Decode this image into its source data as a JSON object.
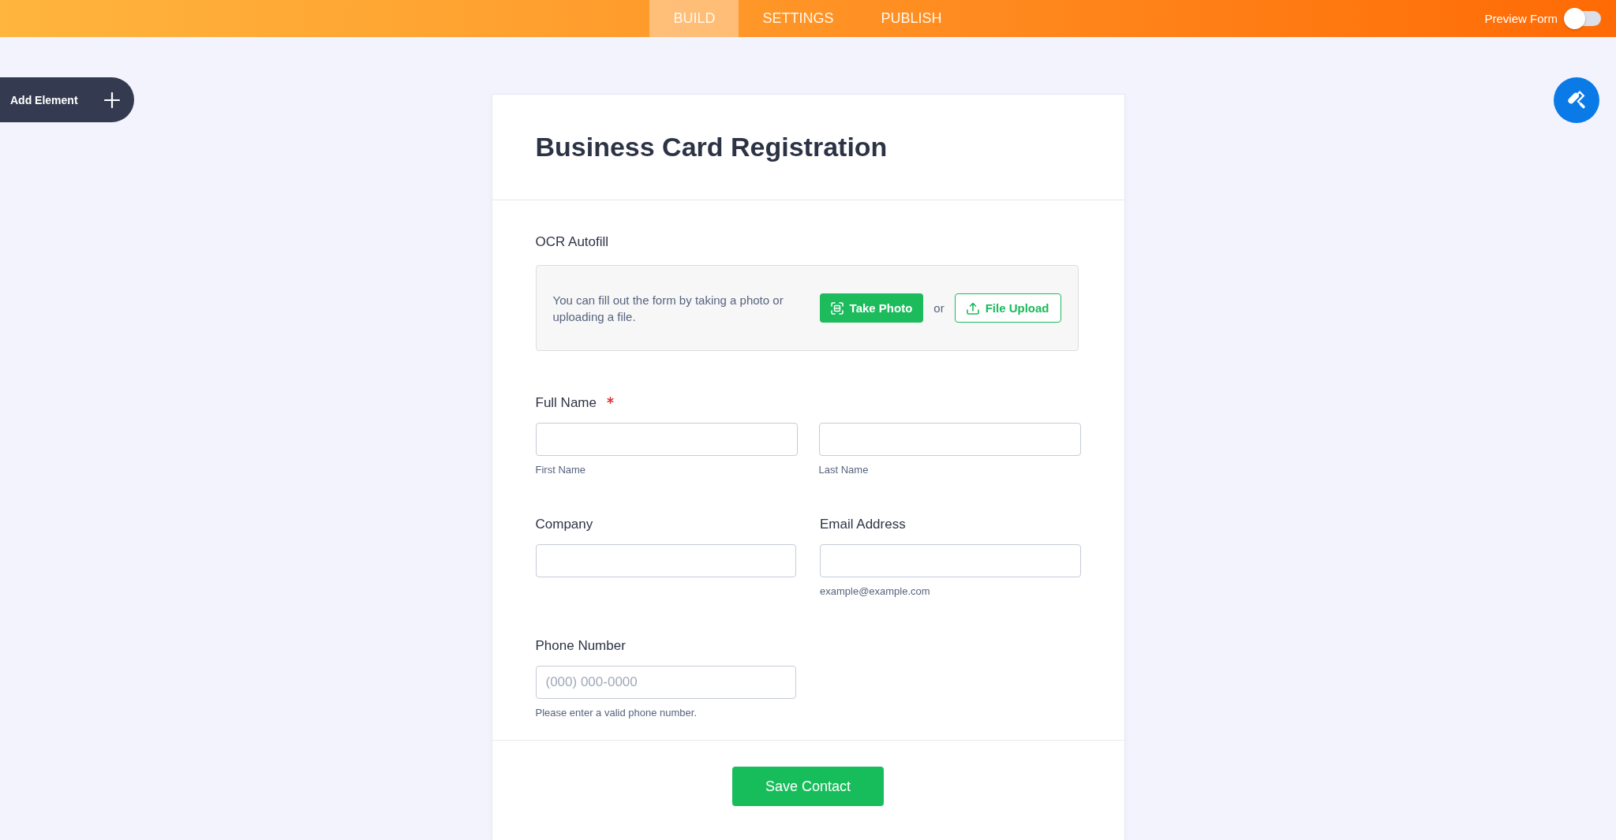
{
  "top_bar": {
    "tabs": [
      {
        "label": "BUILD",
        "selected": true
      },
      {
        "label": "SETTINGS",
        "selected": false
      },
      {
        "label": "PUBLISH",
        "selected": false
      }
    ],
    "preview_toggle": {
      "label": "Preview Form",
      "on": false
    }
  },
  "add_element": {
    "label": "Add Element"
  },
  "form": {
    "title": "Business Card Registration",
    "ocr": {
      "label": "OCR Autofill",
      "description": "You can fill out the form by taking a photo or uploading a file.",
      "buttons": [
        {
          "kind": "photo",
          "label": "Take Photo"
        },
        {
          "kind": "upload",
          "label": "File Upload"
        }
      ],
      "separator": "or"
    },
    "fields": [
      {
        "kind": "pair",
        "label": "Full Name",
        "required": true,
        "sublabels": [
          "First Name",
          "Last Name"
        ]
      },
      {
        "kind": "single",
        "label": "Company",
        "required": false
      },
      {
        "kind": "single",
        "label": "Email Address",
        "required": false,
        "sublabel": "example@example.com"
      },
      {
        "kind": "single",
        "label": "Phone Number",
        "required": false,
        "placeholder": "(000) 000-0000",
        "sublabel": "Please enter a valid phone number."
      }
    ],
    "submit": {
      "label": "Save Contact"
    }
  }
}
